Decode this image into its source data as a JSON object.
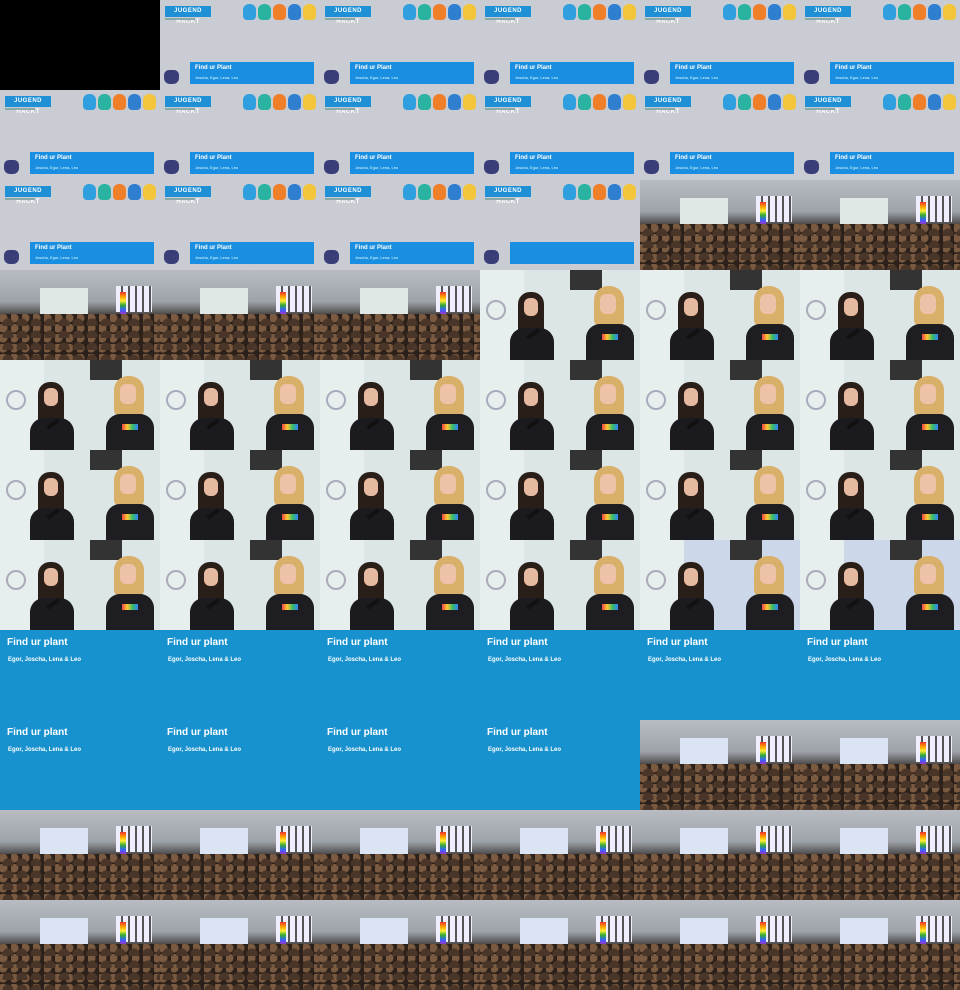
{
  "brand_label": "JUGEND HACKT",
  "talk_title_card": "Find ur Plant",
  "talk_authors_card": "Joscha, Egor, Lena, Leo",
  "talk_title_slide": "Find ur plant",
  "talk_authors_slide": "Egor, Joscha, Lena & Leo",
  "tiles": [
    "black",
    "card",
    "card",
    "card",
    "card",
    "card",
    "card",
    "card",
    "card",
    "card",
    "card",
    "card",
    "card",
    "card",
    "card",
    "card-notitle",
    "hall",
    "hall",
    "hall",
    "hall",
    "hall",
    "speak",
    "speak",
    "speak",
    "speak",
    "speak",
    "speak",
    "speak",
    "speak",
    "speak",
    "speak",
    "speak",
    "speak",
    "speak",
    "speak",
    "speak",
    "speak",
    "speak",
    "speak",
    "speak",
    "speak-blue",
    "speak-blue",
    "slide",
    "slide",
    "slide",
    "slide",
    "slide",
    "slide",
    "slide",
    "slide",
    "slide",
    "slide",
    "hall-blue",
    "hall-blue",
    "hall-blue",
    "hall-blue",
    "hall-blue",
    "hall-blue",
    "hall-blue",
    "hall-blue",
    "hall-blue",
    "hall-blue",
    "hall-blue",
    "hall-blue",
    "hall-blue",
    "hall-blue"
  ]
}
